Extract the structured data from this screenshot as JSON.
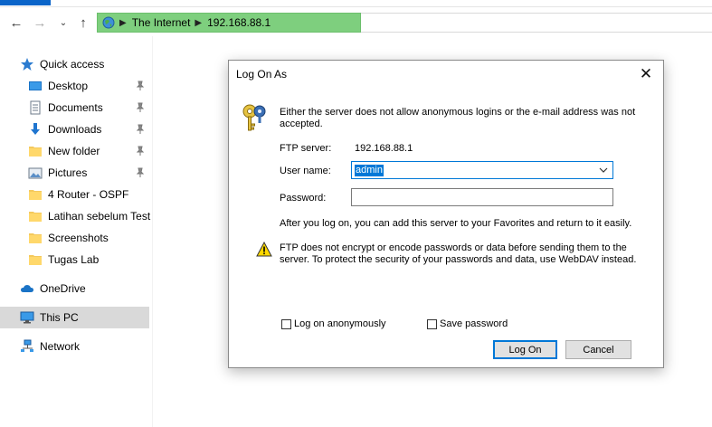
{
  "explorer": {
    "address_crumbs": [
      "The Internet",
      "192.168.88.1"
    ],
    "nav": {
      "back": "back-icon",
      "forward": "forward-icon",
      "recent": "chevron-down-icon",
      "up": "up-icon"
    },
    "sidebar": [
      {
        "label": "Quick access",
        "icon": "star-icon",
        "pinned": false
      },
      {
        "label": "Desktop",
        "icon": "desktop-icon",
        "pinned": true
      },
      {
        "label": "Documents",
        "icon": "documents-icon",
        "pinned": true
      },
      {
        "label": "Downloads",
        "icon": "downloads-icon",
        "pinned": true
      },
      {
        "label": "New folder",
        "icon": "folder-icon",
        "pinned": true
      },
      {
        "label": "Pictures",
        "icon": "pictures-icon",
        "pinned": true
      },
      {
        "label": "4 Router - OSPF",
        "icon": "folder-icon",
        "pinned": false
      },
      {
        "label": "Latihan sebelum Test",
        "icon": "folder-icon",
        "pinned": false
      },
      {
        "label": "Screenshots",
        "icon": "folder-icon",
        "pinned": false
      },
      {
        "label": "Tugas Lab",
        "icon": "folder-icon",
        "pinned": false
      },
      {
        "label": "OneDrive",
        "icon": "cloud-icon",
        "pinned": false
      },
      {
        "label": "This PC",
        "icon": "computer-icon",
        "pinned": false,
        "selected": true
      },
      {
        "label": "Network",
        "icon": "network-icon",
        "pinned": false
      }
    ]
  },
  "dialog": {
    "title": "Log On As",
    "message": "Either the server does not allow anonymous logins or the e-mail address was not accepted.",
    "ftp_server_label": "FTP server:",
    "ftp_server_value": "192.168.88.1",
    "username_label": "User name:",
    "username_value": "admin",
    "password_label": "Password:",
    "password_value": "",
    "info": "After you log on, you can add this server to your Favorites and return to it easily.",
    "warning": "FTP does not encrypt or encode passwords or data before sending them to the server.  To protect the security of your passwords and data, use WebDAV instead.",
    "anonymous_label": "Log on anonymously",
    "anonymous_checked": false,
    "save_password_label": "Save password",
    "save_password_checked": false,
    "logon_button": "Log On",
    "cancel_button": "Cancel"
  },
  "colors": {
    "address_bar": "#7ecf7e",
    "accent": "#0078d7",
    "selection": "#d9d9d9"
  }
}
